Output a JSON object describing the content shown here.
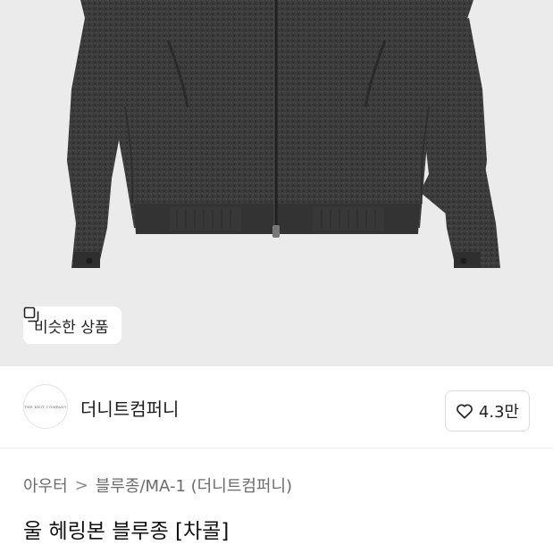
{
  "product_image": {
    "alt": "",
    "similar_button_label": "비슷한 상품"
  },
  "brand": {
    "logo_text": "THE KNIT COMPANY",
    "name": "더니트컴퍼니"
  },
  "like": {
    "count": "4.3만"
  },
  "breadcrumb": {
    "category": "아우터",
    "separator": ">",
    "subcategory": "블루종/MA-1 (더니트컴퍼니)"
  },
  "product": {
    "title": "울 헤링본 블루종 [차콜]"
  },
  "colors": {
    "hero_bg": "#ebebeb",
    "jacket": "#3a3a3a"
  }
}
